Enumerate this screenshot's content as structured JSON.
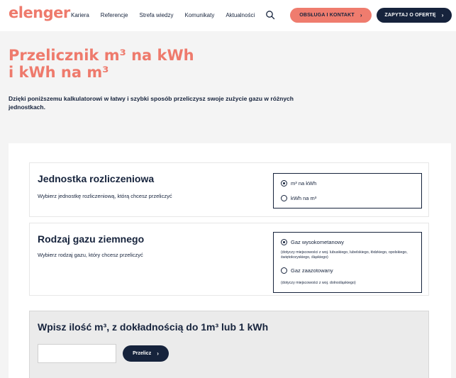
{
  "header": {
    "logo": "elenger",
    "nav": [
      "Kariera",
      "Referencje",
      "Strefa wiedzy",
      "Komunikaty",
      "Aktualności"
    ],
    "service_button": "Obsługa i kontakt",
    "quote_button": "Zapytaj o ofertę",
    "chevron": "›"
  },
  "hero": {
    "title_line1": "Przelicznik m³ na kWh",
    "title_line2": "i kWh na m³",
    "description": "Dzięki poniższemu kalkulatorowi w łatwy i szybki sposób przeliczysz swoje zużycie gazu w różnych jednostkach."
  },
  "unit_section": {
    "title": "Jednostka rozliczeniowa",
    "description": "Wybierz jednostkę rozliczeniową, którą chcesz przeliczyć",
    "options": [
      {
        "label": "m³ na kWh",
        "selected": true
      },
      {
        "label": "kWh na m³",
        "selected": false
      }
    ]
  },
  "gas_section": {
    "title": "Rodzaj gazu ziemnego",
    "description": "Wybierz rodzaj gazu, który chcesz przeliczyć",
    "options": [
      {
        "label": "Gaz wysokometanowy",
        "note": "(dotyczy miejscowości z woj. lubuskiego, lubelskiego, łódzkiego, opolskiego, świętokrzyskiego, śląskiego)",
        "selected": true
      },
      {
        "label": "Gaz zaazotowany",
        "note": "(dotyczy miejscowości z woj. dolnośląskiego)",
        "selected": false
      }
    ]
  },
  "entry": {
    "title": "Wpisz ilość m³, z dokładnością do 1m³ lub 1 kWh",
    "input_value": "",
    "calc_button": "Przelicz",
    "chevron": "›"
  },
  "colors": {
    "brand_coral": "#ee7a6c",
    "navy": "#16233c"
  }
}
